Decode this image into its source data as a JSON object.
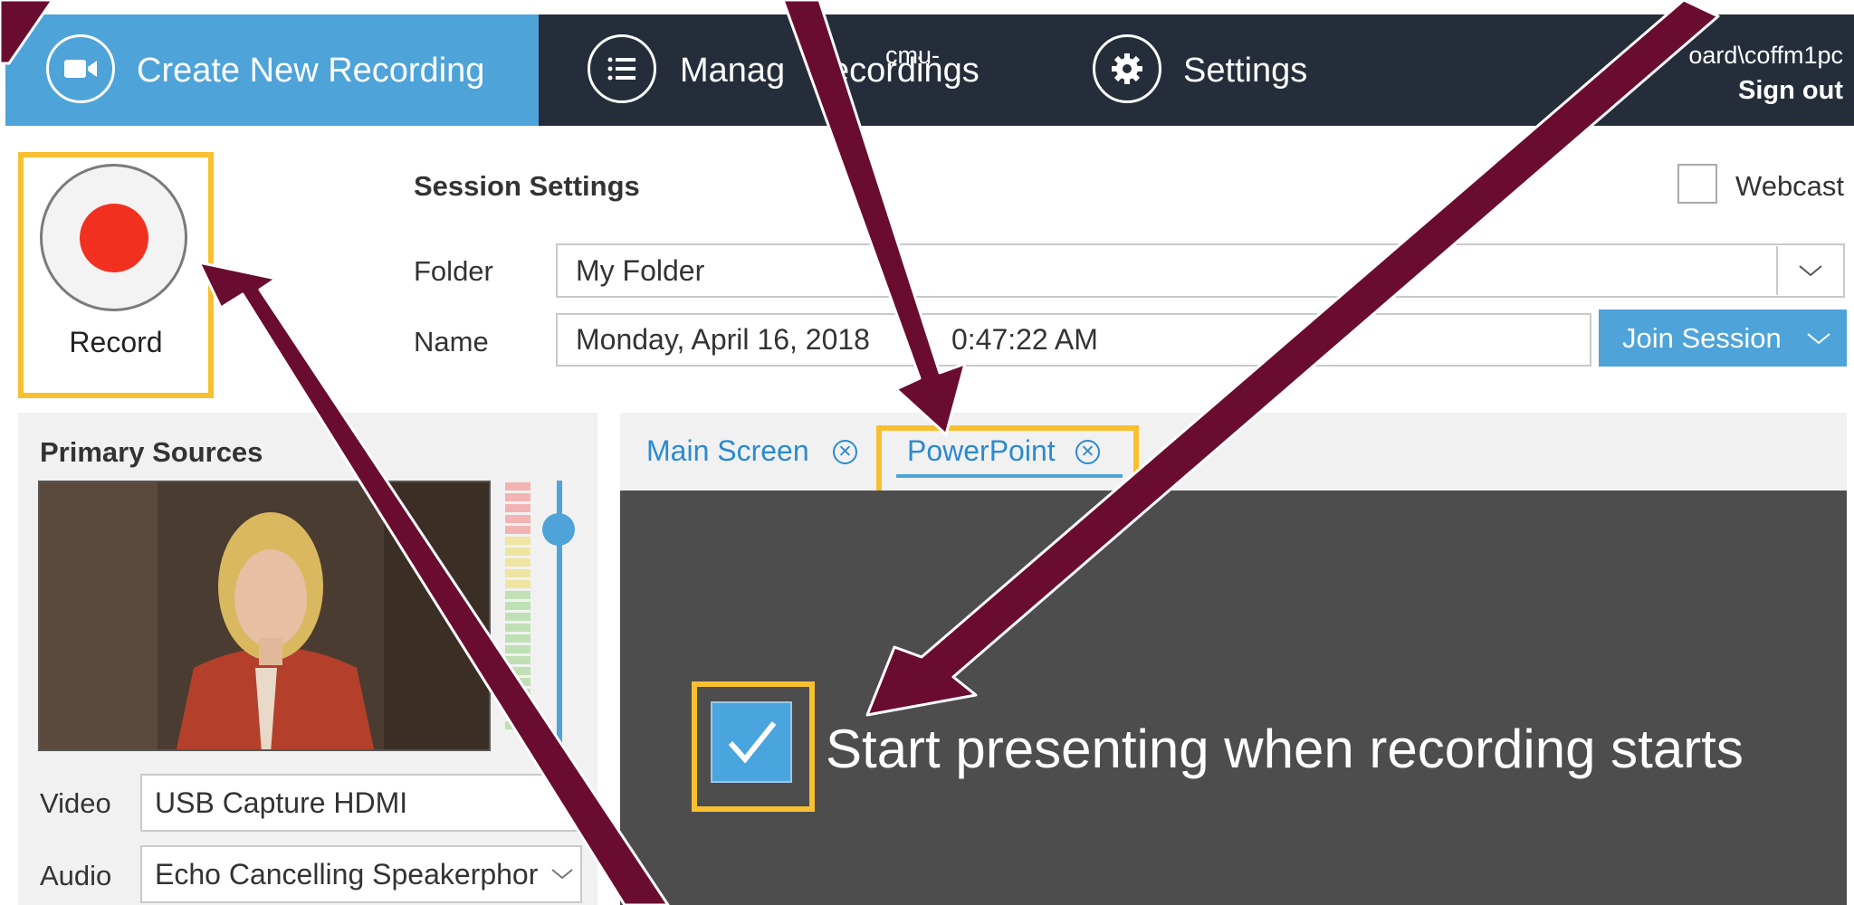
{
  "nav": {
    "create_label": "Create New Recording",
    "manage_label": "Manag",
    "manage_label_tail": "ecordings",
    "settings_label": "Settings",
    "account_prefix": "cmu-",
    "account_suffix": "oard\\coffm1pc",
    "sign_out": "Sign out"
  },
  "record": {
    "label": "Record"
  },
  "session": {
    "heading": "Session Settings",
    "webcast_label": "Webcast",
    "folder_label": "Folder",
    "folder_value": "My Folder",
    "name_label": "Name",
    "name_value_part1": "Monday, April 16, 2018",
    "name_value_part2": "0:47:22 AM",
    "join_label": "Join Session"
  },
  "primary": {
    "heading": "Primary Sources",
    "video_label": "Video",
    "video_value": "USB Capture HDMI",
    "audio_label": "Audio",
    "audio_value": "Echo Cancelling Speakerphor"
  },
  "tabs": [
    {
      "label": "Main Screen"
    },
    {
      "label": "PowerPoint"
    }
  ],
  "powerpoint": {
    "start_presenting_label": "Start presenting when recording starts",
    "start_presenting_checked": true
  },
  "colors": {
    "accent": "#4ea3d9",
    "nav_dark": "#262d3a",
    "highlight": "#f8c030",
    "annotation_arrow": "#6a0c30",
    "record_red": "#f2301f"
  }
}
